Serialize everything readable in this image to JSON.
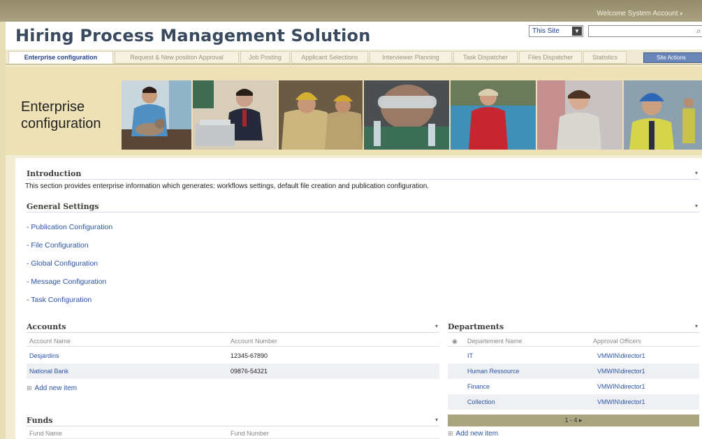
{
  "topbar": {
    "welcome": "Welcome System Account",
    "arrow": "▾"
  },
  "header": {
    "title": "Hiring Process Management Solution",
    "scope_value": "This Site",
    "search_placeholder": "",
    "search_icon": "search-icon"
  },
  "tabs": [
    {
      "label": "Enterprise configuration",
      "active": true
    },
    {
      "label": "Request & New position Approval"
    },
    {
      "label": "Job Posting"
    },
    {
      "label": "Applicant Selections"
    },
    {
      "label": "Interviewer Planning"
    },
    {
      "label": "Task Dispatcher"
    },
    {
      "label": "Files Dispatcher"
    },
    {
      "label": "Statistics"
    }
  ],
  "site_actions": "Site Actions",
  "banner": {
    "title_line1": "Enterprise",
    "title_line2": "configuration",
    "photos": [
      "veterinarian-with-cat",
      "businessman-at-laptop",
      "firefighters",
      "lab-scientist-goggles",
      "lifeguard-at-pool",
      "young-man-portrait",
      "construction-worker-hardhat"
    ]
  },
  "introduction": {
    "title": "Introduction",
    "text": "This section provides enterprise information which generates: workflows settings, default file creation and publication configuration."
  },
  "general_settings": {
    "title": "General Settings",
    "links": [
      "- Publication Configuration",
      "- File Configuration",
      "- Global Configuration",
      "- Message Configuration",
      "- Task Configuration"
    ]
  },
  "accounts": {
    "title": "Accounts",
    "columns": [
      "Account Name",
      "Account Number"
    ],
    "rows": [
      [
        "Desjardins",
        "12345-67890"
      ],
      [
        "National Bank",
        "09876-54321"
      ]
    ],
    "add_new": "Add new item"
  },
  "funds": {
    "title": "Funds",
    "columns": [
      "Fund Name",
      "Fund Number"
    ]
  },
  "departments": {
    "title": "Departments",
    "columns": [
      "Departement Name",
      "Approval Officers"
    ],
    "rows": [
      [
        "IT",
        "VMWIN\\director1"
      ],
      [
        "Human Ressource",
        "VMWIN\\director1"
      ],
      [
        "Finance",
        "VMWIN\\director1"
      ],
      [
        "Collection",
        "VMWIN\\director1"
      ]
    ],
    "pager": "1 - 4 ▸",
    "add_new": "Add new item"
  },
  "colors": {
    "accent_link": "#2b54a8",
    "title": "#3a4a5e",
    "banner_bg": "#eee1b6",
    "topbar": "#948b6a"
  }
}
